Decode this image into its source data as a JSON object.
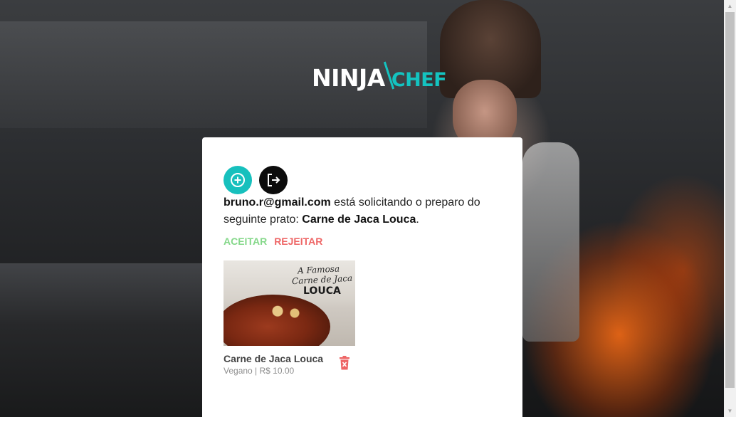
{
  "brand": {
    "ninja": "NINJA",
    "chef": "CHEF",
    "accent_color": "#14c3c0"
  },
  "toolbar": {
    "add_icon": "plus-circle-icon",
    "logout_icon": "logout-icon"
  },
  "request": {
    "email": "bruno.r@gmail.com",
    "text_before": " está solicitando o preparo do seguinte prato: ",
    "dish": "Carne de Jaca Louca",
    "text_after": "."
  },
  "actions": {
    "accept_label": "ACEITAR",
    "reject_label": "REJEITAR",
    "accept_color": "#85d88a",
    "reject_color": "#ee6666"
  },
  "dish_card": {
    "image_text": [
      "A Famosa",
      "Carne de Jaca",
      "LOUCA"
    ],
    "name": "Carne de Jaca Louca",
    "meta": "Vegano | R$ 10.00",
    "delete_icon": "trash-icon",
    "delete_color": "#ee6666"
  }
}
